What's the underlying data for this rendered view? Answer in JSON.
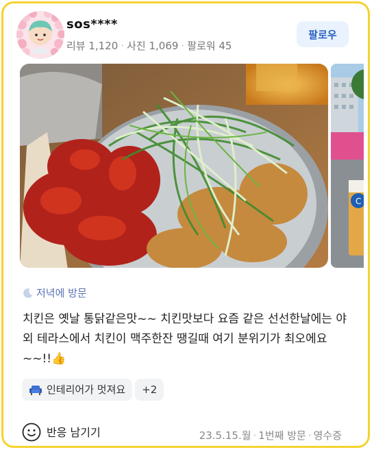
{
  "user": {
    "name": "sos****",
    "stats": [
      "리뷰 1,120",
      "사진 1,069",
      "팔로워 45"
    ],
    "follow_label": "팔로우"
  },
  "visit": {
    "icon": "moon-icon",
    "label": "저녁에 방문"
  },
  "review_text": "치킨은 옛날 통닭같은맛~~ 치킨맛보다 요즘 같은 선선한날에는 야외 테라스에서 치킨이 맥주한잔 땡길때 여기 분위기가 최오에요~~!!👍",
  "chips": [
    {
      "icon": "sofa-icon",
      "label": "인테리어가 멋져요"
    },
    {
      "label": "+2"
    }
  ],
  "footer": {
    "react_label": "반응 남기기",
    "meta": [
      "23.5.15.월",
      "1번째 방문",
      "영수증"
    ]
  },
  "colors": {
    "card_border": "#f5d22e",
    "accent_blue": "#2c64c6",
    "follow_bg": "#eaf2fd"
  }
}
